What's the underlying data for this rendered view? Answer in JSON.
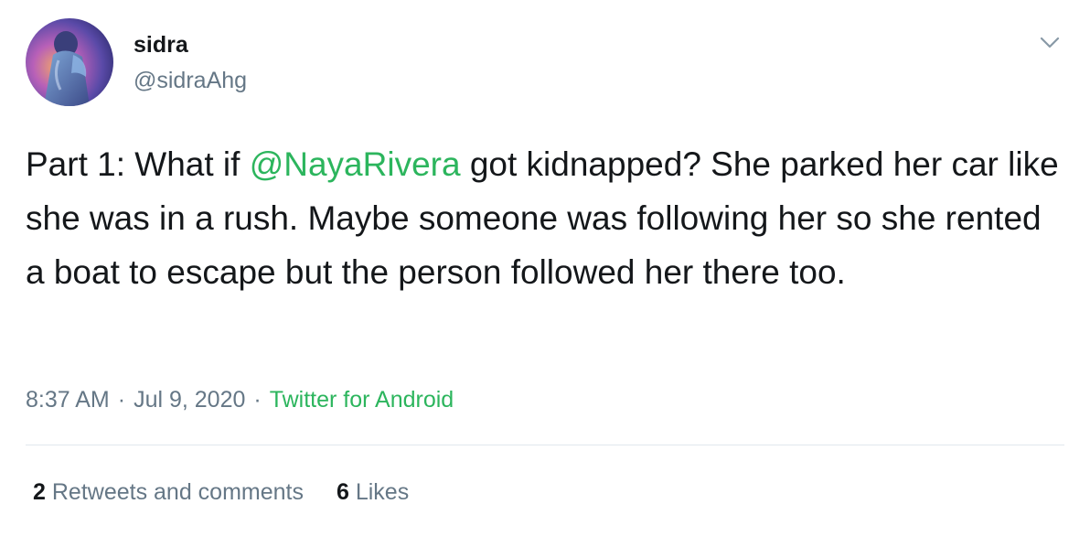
{
  "user": {
    "display_name": "sidra",
    "handle": "@sidraAhg"
  },
  "menu": {
    "caret_icon": "chevron-down-icon"
  },
  "tweet": {
    "text_prefix": "Part 1: What if ",
    "mention": "@NayaRivera",
    "text_suffix": " got kidnapped? She parked her car like she was in a rush. Maybe someone was following her so she rented a boat to escape but the person followed her there too."
  },
  "meta": {
    "time": "8:37 AM",
    "sep1": "·",
    "date": "Jul 9, 2020",
    "sep2": "·",
    "source": "Twitter for Android"
  },
  "stats": {
    "retweets_count": "2",
    "retweets_label": "Retweets and comments",
    "likes_count": "6",
    "likes_label": "Likes"
  },
  "colors": {
    "text": "#14171a",
    "secondary": "#657786",
    "link": "#2cb55d",
    "divider": "#e1e8ed"
  }
}
